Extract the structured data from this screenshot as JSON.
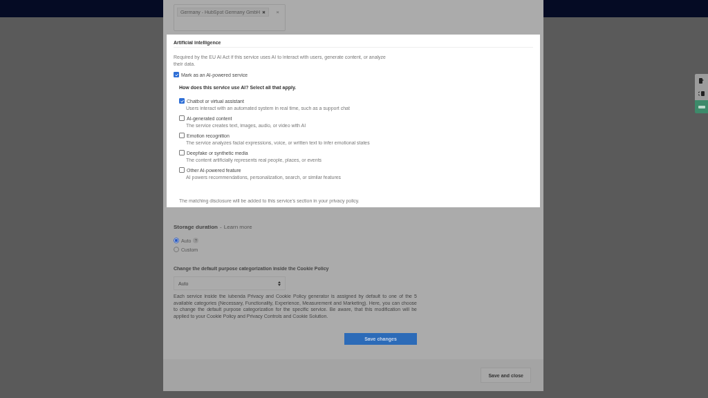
{
  "tag_field": {
    "tags": [
      {
        "label": "Germany - HubSpot Germany GmbH",
        "remove": "✖"
      }
    ],
    "clear": "×"
  },
  "ai_section": {
    "title": "Artificial intelligence",
    "description": "Required by the EU AI Act if this service uses AI to interact with users, generate content, or analyze their data.",
    "mark_ai": {
      "label": "Mark as an AI-powered service",
      "checked": true
    },
    "question": "How does this service use AI? Select all that apply.",
    "options": [
      {
        "label": "Chatbot or virtual assistant",
        "description": "Users interact with an automated system in real time, such as a support chat",
        "checked": true
      },
      {
        "label": "AI-generated content",
        "description": "The service creates text, images, audio, or video with AI",
        "checked": false
      },
      {
        "label": "Emotion recognition",
        "description": "The service analyzes facial expressions, voice, or written text to infer emotional states",
        "checked": false
      },
      {
        "label": "Deepfake or synthetic media",
        "description": "The content artificially represents real people, places, or events",
        "checked": false
      },
      {
        "label": "Other AI-powered feature",
        "description": "AI powers recommendations, personalization, search, or similar features",
        "checked": false
      }
    ],
    "footnote": "The matching disclosure will be added to this service's section in your privacy policy."
  },
  "storage": {
    "title": "Storage duration",
    "separator": "-",
    "link": "Learn more",
    "options": [
      {
        "label": "Auto",
        "selected": true,
        "help": "?"
      },
      {
        "label": "Custom",
        "selected": false
      }
    ]
  },
  "categorization": {
    "title": "Change the default purpose categorization inside the Cookie Policy",
    "select": {
      "value": "Auto"
    },
    "description": "Each service inside the iubenda Privacy and Cookie Policy generator is assigned by default to one of the 5 available categories (Necessary, Functionality, Experience, Measurement and Marketing). Here, you can choose to change the default purpose categorization for the specific service. Be aware, that this modification will be applied to your Cookie Policy and Privacy Controls and Cookie Solution."
  },
  "save_button": "Save changes",
  "footer": {
    "button": "Save and close"
  }
}
